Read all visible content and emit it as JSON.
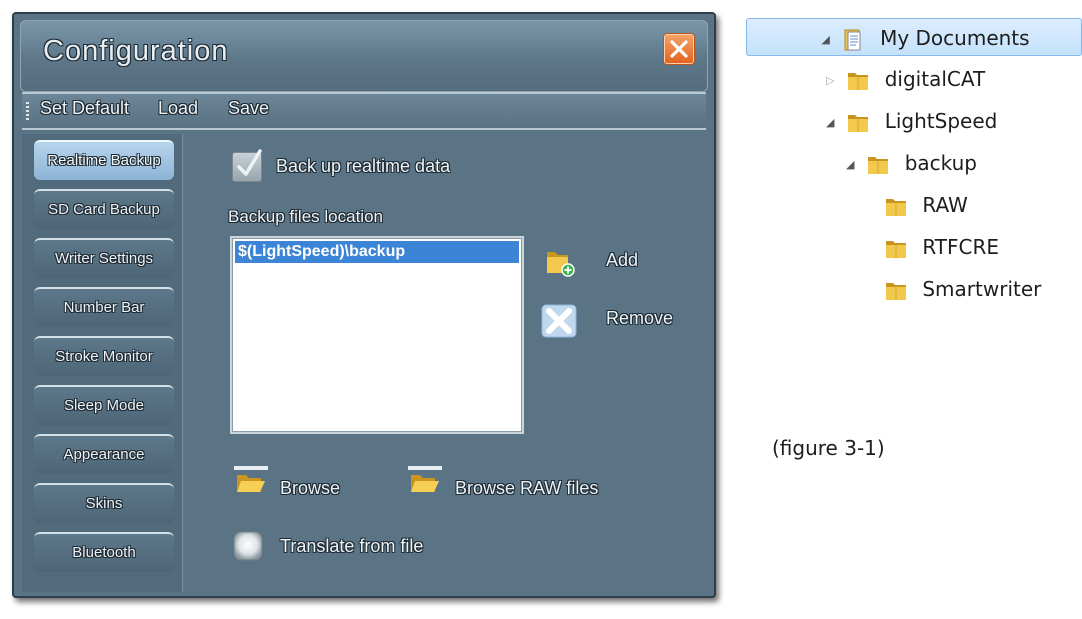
{
  "window": {
    "title": "Configuration",
    "close_icon": "close-icon"
  },
  "menu": {
    "items": [
      "Set Default",
      "Load",
      "Save"
    ]
  },
  "sidebar": {
    "items": [
      {
        "label": "Realtime Backup",
        "active": true
      },
      {
        "label": "SD Card Backup",
        "active": false
      },
      {
        "label": "Writer Settings",
        "active": false
      },
      {
        "label": "Number Bar",
        "active": false
      },
      {
        "label": "Stroke Monitor",
        "active": false
      },
      {
        "label": "Sleep Mode",
        "active": false
      },
      {
        "label": "Appearance",
        "active": false
      },
      {
        "label": "Skins",
        "active": false
      },
      {
        "label": "Bluetooth",
        "active": false
      }
    ]
  },
  "realtime_backup": {
    "checkbox_label": "Back up realtime data",
    "checkbox_checked": true,
    "location_label": "Backup files location",
    "locations": [
      "$(LightSpeed)\\backup"
    ],
    "add_label": "Add",
    "remove_label": "Remove",
    "browse_label": "Browse",
    "browse_raw_label": "Browse RAW files",
    "translate_label": "Translate from file"
  },
  "tree": {
    "items": [
      {
        "label": "My Documents",
        "level": 0,
        "expanded": true,
        "has_children": true,
        "selected": true,
        "icon": "documents-folder-icon"
      },
      {
        "label": "digitalCAT",
        "level": 1,
        "expanded": false,
        "has_children": true,
        "selected": false,
        "icon": "folder-icon"
      },
      {
        "label": "LightSpeed",
        "level": 1,
        "expanded": true,
        "has_children": true,
        "selected": false,
        "icon": "folder-icon"
      },
      {
        "label": "backup",
        "level": 2,
        "expanded": true,
        "has_children": true,
        "selected": false,
        "icon": "folder-icon"
      },
      {
        "label": "RAW",
        "level": 3,
        "expanded": false,
        "has_children": false,
        "selected": false,
        "icon": "folder-icon"
      },
      {
        "label": "RTFCRE",
        "level": 3,
        "expanded": false,
        "has_children": false,
        "selected": false,
        "icon": "folder-icon"
      },
      {
        "label": "Smartwriter",
        "level": 3,
        "expanded": false,
        "has_children": false,
        "selected": false,
        "icon": "folder-icon"
      }
    ]
  },
  "caption": "(figure 3-1)",
  "colors": {
    "window_bg": "#5a7486",
    "active_tab": "#a9cbe6",
    "selection": "#3c85d6",
    "close_button": "#e86a2a"
  }
}
